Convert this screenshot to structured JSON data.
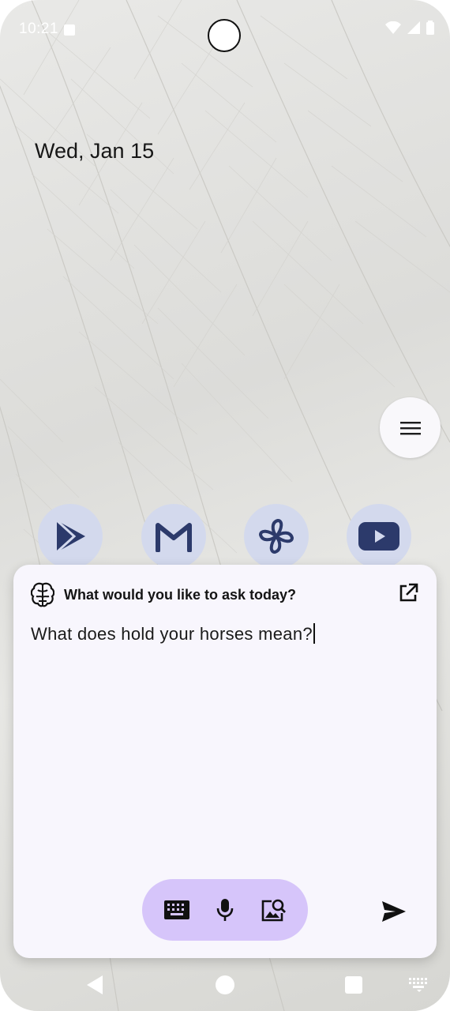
{
  "status_bar": {
    "time": "10:21",
    "icons": [
      "notification-a-icon",
      "wifi-icon",
      "signal-icon",
      "battery-icon"
    ]
  },
  "home": {
    "date": "Wed, Jan 15",
    "menu_icon": "hamburger-menu-icon",
    "apps": [
      {
        "name": "play-store-icon"
      },
      {
        "name": "gmail-icon"
      },
      {
        "name": "pinwheel-icon"
      },
      {
        "name": "youtube-icon"
      }
    ]
  },
  "assistant": {
    "title": "What would you like to ask today?",
    "query": "What does hold your horses mean?",
    "icons": {
      "header": "brain-icon",
      "open": "open-external-icon",
      "keyboard": "keyboard-icon",
      "mic": "microphone-icon",
      "image_search": "image-search-icon",
      "send": "send-icon"
    }
  },
  "nav_bar": {
    "icons": [
      "back-icon",
      "home-icon",
      "recents-icon",
      "keyboard-switch-icon"
    ]
  },
  "colors": {
    "panel_bg": "#f8f6fd",
    "tool_pill": "#d6c5fa",
    "app_icon_bg": "#d3d9ed",
    "app_icon_fg": "#2c3a6b"
  }
}
